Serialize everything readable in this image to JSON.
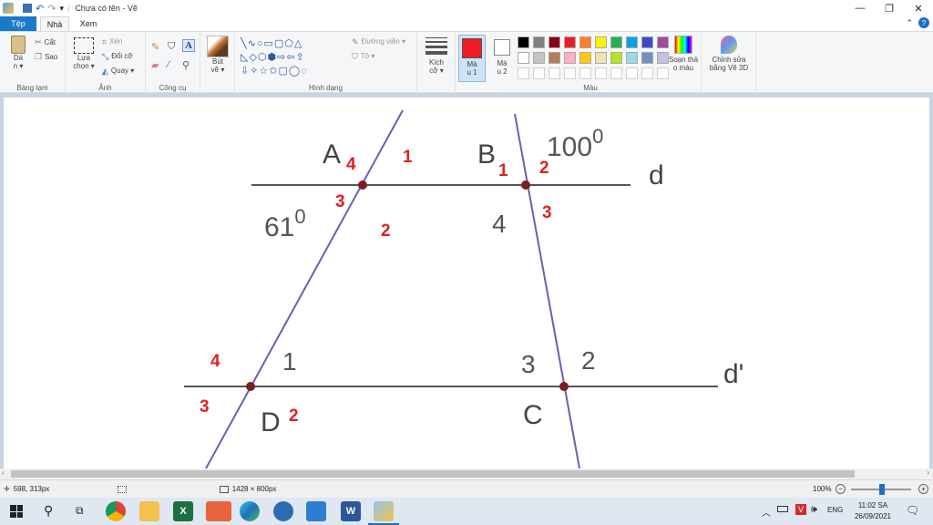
{
  "window": {
    "title": "Chưa có tên - Vẽ"
  },
  "tabs": {
    "file": "Tệp",
    "home": "Nhà",
    "view": "Xem"
  },
  "ribbon": {
    "clipboard": {
      "paste": "Dá",
      "paste2": "n ▾",
      "cut": "Cắt",
      "copy": "Sao",
      "label": "Bảng tạm"
    },
    "image": {
      "select": "Lựa",
      "select2": "chọn ▾",
      "crop": "Xén",
      "resize": "Đổi cỡ",
      "rotate": "Quay ▾",
      "label": "Ảnh"
    },
    "tools": {
      "label": "Công cụ"
    },
    "brushes": {
      "label": "Bút",
      "label2": "vẽ ▾"
    },
    "shapes": {
      "outline": "Đường viền ▾",
      "fill": "Tô ▾",
      "label": "Hình dạng"
    },
    "size": {
      "label": "Kích",
      "label2": "cỡ ▾"
    },
    "color1": {
      "label": "Mà",
      "label2": "u 1"
    },
    "color2": {
      "label": "Mà",
      "label2": "u 2"
    },
    "colors": {
      "label": "Màu"
    },
    "edit_colors": {
      "label": "Soạn thả",
      "label2": "o màu"
    },
    "paint3d": {
      "label": "Chỉnh sửa",
      "label2": "bằng Vẽ 3D"
    },
    "color1_value": "#ed1c24",
    "color2_value": "#ffffff",
    "palette": [
      "#000000",
      "#7f7f7f",
      "#880015",
      "#ed1c24",
      "#ff7f27",
      "#fff200",
      "#22b14c",
      "#00a2e8",
      "#3f48cc",
      "#a349a4",
      "#ffffff",
      "#c3c3c3",
      "#b97a57",
      "#ffaec9",
      "#ffc90e",
      "#efe4b0",
      "#b5e61d",
      "#99d9ea",
      "#7092be",
      "#c8bfe7"
    ]
  },
  "drawing": {
    "points": {
      "A": "A",
      "B": "B",
      "C": "C",
      "D": "D"
    },
    "lines": {
      "d": "d",
      "d_prime": "d'"
    },
    "angles": {
      "b_outer": "100",
      "b_outer_sup": "0",
      "a_inner": "61",
      "a_inner_sup": "0"
    },
    "red_labels": {
      "a4": "4",
      "a1": "1",
      "a3": "3",
      "a2": "2",
      "b1": "1",
      "b2": "2",
      "b3": "3",
      "d4": "4",
      "d3": "3",
      "d2": "2"
    },
    "black_labels": {
      "b4": "4",
      "d1": "1",
      "c3": "3",
      "c2": "2"
    }
  },
  "status": {
    "cursor": "598, 313px",
    "size": "1428 × 800px",
    "zoom": "100%"
  },
  "taskbar": {
    "lang": "ENG",
    "time": "11:02 SA",
    "date": "26/09/2021"
  }
}
